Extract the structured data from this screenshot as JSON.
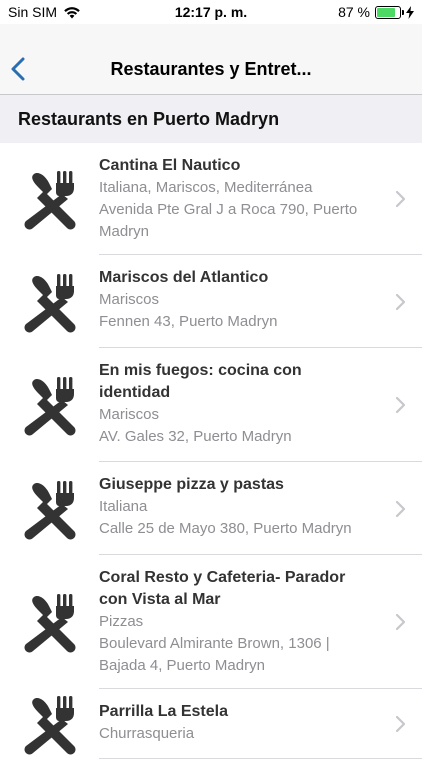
{
  "status_bar": {
    "carrier": "Sin SIM",
    "time": "12:17 p. m.",
    "battery_percent_label": "87 %",
    "battery_level": 0.87
  },
  "nav_bar": {
    "title": "Restaurantes y Entret..."
  },
  "section": {
    "title": "Restaurants en Puerto Madryn"
  },
  "restaurants": [
    {
      "name_lines": [
        "Cantina El Nautico"
      ],
      "category": "Italiana, Mariscos, Mediterránea",
      "address_lines": [
        "Avenida Pte Gral J a Roca 790, Puerto",
        "Madryn"
      ]
    },
    {
      "name_lines": [
        "Mariscos del Atlantico"
      ],
      "category": "Mariscos",
      "address_lines": [
        "Fennen 43, Puerto Madryn"
      ]
    },
    {
      "name_lines": [
        "En mis fuegos: cocina con",
        "identidad"
      ],
      "category": "Mariscos",
      "address_lines": [
        "AV. Gales 32, Puerto Madryn"
      ]
    },
    {
      "name_lines": [
        "Giuseppe pizza y pastas"
      ],
      "category": "Italiana",
      "address_lines": [
        "Calle 25 de Mayo 380, Puerto Madryn"
      ]
    },
    {
      "name_lines": [
        "Coral Resto y Cafeteria- Parador",
        "con Vista al Mar"
      ],
      "category": "Pizzas",
      "address_lines": [
        "Boulevard Almirante Brown, 1306 |",
        "Bajada 4, Puerto Madryn"
      ]
    },
    {
      "name_lines": [
        "Parrilla La Estela"
      ],
      "category": "Churrasqueria",
      "address_lines": []
    }
  ],
  "icons": {
    "row_icon": "fork-knife-icon",
    "row_chevron": "chevron-right-icon",
    "back": "chevron-left-icon"
  },
  "colors": {
    "accent": "#2a6db0",
    "icon": "#333333",
    "secondary_text": "#8e8e93",
    "battery": "#4cd964"
  }
}
